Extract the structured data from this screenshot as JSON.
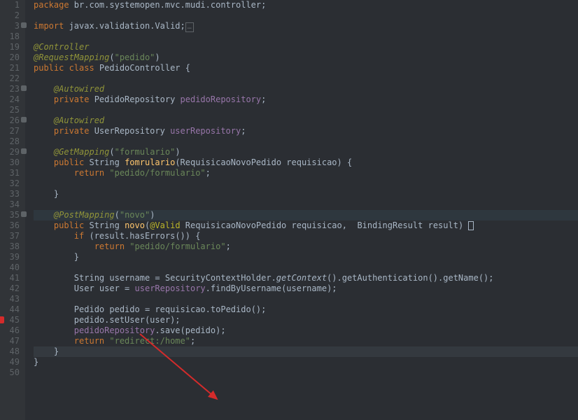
{
  "lines": [
    {
      "n": "1",
      "t": [
        [
          "kw",
          "package"
        ],
        [
          "pkg",
          " br.com.systemopen.mvc.mudi.controller"
        ],
        [
          "punc",
          ";"
        ]
      ]
    },
    {
      "n": "2",
      "t": []
    },
    {
      "n": "3",
      "fold": true,
      "t": [
        [
          "kw",
          "import"
        ],
        [
          "pkg",
          " javax.validation.Valid"
        ],
        [
          "punc",
          ";"
        ],
        [
          "folded",
          ""
        ]
      ]
    },
    {
      "n": "18",
      "t": []
    },
    {
      "n": "19",
      "t": [
        [
          "anno-it",
          "@Controller"
        ]
      ]
    },
    {
      "n": "20",
      "t": [
        [
          "anno-it",
          "@RequestMapping"
        ],
        [
          "punc",
          "("
        ],
        [
          "str",
          "\"pedido\""
        ],
        [
          "punc",
          ")"
        ]
      ]
    },
    {
      "n": "21",
      "t": [
        [
          "kw",
          "public class "
        ],
        [
          "cls-def",
          "PedidoController"
        ],
        [
          "punc",
          " {"
        ]
      ]
    },
    {
      "n": "22",
      "t": []
    },
    {
      "n": "23",
      "fold": true,
      "indent": "    ",
      "t": [
        [
          "anno-it",
          "@Autowired"
        ]
      ]
    },
    {
      "n": "24",
      "indent": "    ",
      "t": [
        [
          "kw",
          "private "
        ],
        [
          "type",
          "PedidoRepository "
        ],
        [
          "field",
          "pedidoRepository"
        ],
        [
          "punc",
          ";"
        ]
      ]
    },
    {
      "n": "25",
      "t": []
    },
    {
      "n": "26",
      "fold": true,
      "indent": "    ",
      "t": [
        [
          "anno-it",
          "@Autowired"
        ]
      ]
    },
    {
      "n": "27",
      "indent": "    ",
      "t": [
        [
          "kw",
          "private "
        ],
        [
          "type",
          "UserRepository "
        ],
        [
          "field",
          "userRepository"
        ],
        [
          "punc",
          ";"
        ]
      ]
    },
    {
      "n": "28",
      "t": []
    },
    {
      "n": "29",
      "fold": true,
      "indent": "    ",
      "t": [
        [
          "anno-it",
          "@GetMapping"
        ],
        [
          "punc",
          "("
        ],
        [
          "str",
          "\"formulario\""
        ],
        [
          "punc",
          ")"
        ]
      ]
    },
    {
      "n": "30",
      "indent": "    ",
      "t": [
        [
          "kw",
          "public "
        ],
        [
          "type",
          "String "
        ],
        [
          "method",
          "fomrulario"
        ],
        [
          "punc",
          "("
        ],
        [
          "type",
          "RequisicaoNovoPedido "
        ],
        [
          "param",
          "requisicao"
        ],
        [
          "punc",
          ") {"
        ]
      ]
    },
    {
      "n": "31",
      "indent": "        ",
      "t": [
        [
          "kw",
          "return "
        ],
        [
          "str",
          "\"pedido/formulario\""
        ],
        [
          "punc",
          ";"
        ]
      ]
    },
    {
      "n": "32",
      "t": []
    },
    {
      "n": "33",
      "indent": "    ",
      "t": [
        [
          "punc",
          "}"
        ]
      ]
    },
    {
      "n": "34",
      "t": []
    },
    {
      "n": "35",
      "fold": true,
      "hl": "hl35",
      "indent": "    ",
      "t": [
        [
          "anno-it",
          "@PostMapping"
        ],
        [
          "punc",
          "("
        ],
        [
          "str",
          "\"novo\""
        ],
        [
          "punc",
          ")"
        ]
      ]
    },
    {
      "n": "36",
      "indent": "    ",
      "t": [
        [
          "kw",
          "public "
        ],
        [
          "type",
          "String "
        ],
        [
          "method",
          "novo"
        ],
        [
          "punc",
          "("
        ],
        [
          "anno",
          "@Valid "
        ],
        [
          "type",
          "RequisicaoNovoPedido "
        ],
        [
          "param",
          "requisicao"
        ],
        [
          "punc",
          ",  "
        ],
        [
          "type",
          "BindingResult "
        ],
        [
          "param",
          "result"
        ],
        [
          "punc",
          ") "
        ],
        [
          "caret",
          ""
        ]
      ]
    },
    {
      "n": "37",
      "indent": "        ",
      "t": [
        [
          "kw",
          "if "
        ],
        [
          "punc",
          "(result."
        ],
        [
          "call",
          "hasErrors"
        ],
        [
          "punc",
          "()) {"
        ]
      ]
    },
    {
      "n": "38",
      "indent": "            ",
      "t": [
        [
          "kw",
          "return "
        ],
        [
          "str",
          "\"pedido/formulario\""
        ],
        [
          "punc",
          ";"
        ]
      ]
    },
    {
      "n": "39",
      "indent": "        ",
      "t": [
        [
          "punc",
          "}"
        ]
      ]
    },
    {
      "n": "40",
      "t": []
    },
    {
      "n": "41",
      "indent": "        ",
      "t": [
        [
          "type",
          "String "
        ],
        [
          "var",
          "username"
        ],
        [
          "punc",
          " = SecurityContextHolder."
        ],
        [
          "static-call",
          "getContext"
        ],
        [
          "punc",
          "()."
        ],
        [
          "call",
          "getAuthentication"
        ],
        [
          "punc",
          "()."
        ],
        [
          "call",
          "getName"
        ],
        [
          "punc",
          "();"
        ]
      ]
    },
    {
      "n": "42",
      "indent": "        ",
      "t": [
        [
          "type",
          "User "
        ],
        [
          "var",
          "user"
        ],
        [
          "punc",
          " = "
        ],
        [
          "field",
          "userRepository"
        ],
        [
          "punc",
          "."
        ],
        [
          "call",
          "findByUsername"
        ],
        [
          "punc",
          "(username);"
        ]
      ]
    },
    {
      "n": "43",
      "t": []
    },
    {
      "n": "44",
      "indent": "        ",
      "t": [
        [
          "type",
          "Pedido "
        ],
        [
          "var",
          "pedido"
        ],
        [
          "punc",
          " = requisicao."
        ],
        [
          "call",
          "toPedido"
        ],
        [
          "punc",
          "();"
        ]
      ]
    },
    {
      "n": "45",
      "err": true,
      "indent": "        ",
      "t": [
        [
          "punc",
          "pedido."
        ],
        [
          "call",
          "setUser"
        ],
        [
          "punc",
          "(user);"
        ]
      ]
    },
    {
      "n": "46",
      "indent": "        ",
      "t": [
        [
          "field",
          "pedidoRepository"
        ],
        [
          "punc",
          "."
        ],
        [
          "call",
          "save"
        ],
        [
          "punc",
          "(pedido);"
        ]
      ]
    },
    {
      "n": "47",
      "indent": "        ",
      "t": [
        [
          "kw",
          "return "
        ],
        [
          "str",
          "\"redirect:/home\""
        ],
        [
          "punc",
          ";"
        ]
      ]
    },
    {
      "n": "48",
      "hl": "hl48",
      "indent": "    ",
      "t": [
        [
          "punc",
          "}"
        ]
      ]
    },
    {
      "n": "49",
      "t": [
        [
          "punc",
          "}"
        ]
      ]
    },
    {
      "n": "50",
      "t": []
    }
  ]
}
